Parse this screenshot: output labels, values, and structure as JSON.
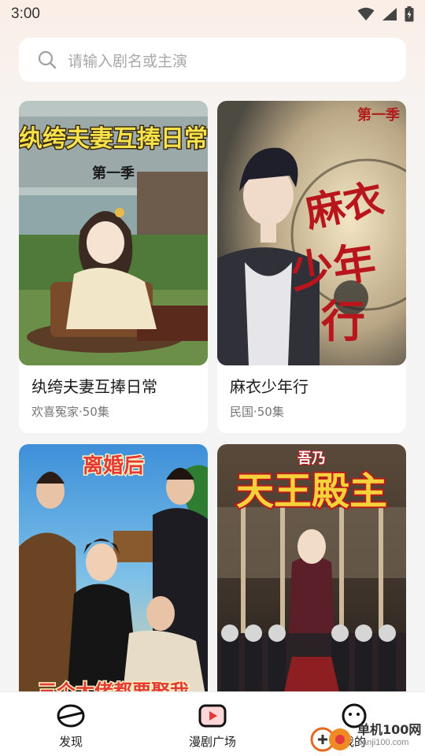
{
  "status_bar": {
    "time": "3:00"
  },
  "search": {
    "placeholder": "请输入剧名或主演"
  },
  "cards": [
    {
      "title": "纨绔夫妻互捧日常",
      "meta": "欢喜冤家·50集",
      "cover_title": "纨绔夫妻互捧日常",
      "cover_season": "第一季"
    },
    {
      "title": "麻衣少年行",
      "meta": "民国·50集",
      "cover_title": "麻衣少年行",
      "cover_season": "第一季"
    },
    {
      "title": "",
      "meta": "",
      "cover_title": "离婚后",
      "cover_subtitle": "三个大佬都要娶我"
    },
    {
      "title": "",
      "meta": "",
      "cover_title": "吾乃天王殿主",
      "cover_top": "吾乃",
      "cover_main": "天王殿主"
    }
  ],
  "tab_bar": {
    "items": [
      {
        "label": "发现",
        "icon": "discover-icon"
      },
      {
        "label": "漫剧广场",
        "icon": "play-square-icon"
      },
      {
        "label": "我的",
        "icon": "profile-face-icon"
      }
    ]
  },
  "watermark": {
    "main": "单机100网",
    "sub": "danji100.com"
  },
  "colors": {
    "background": "#f4f4f4",
    "card": "#ffffff",
    "placeholder": "#a8a8a8",
    "meta": "#777777",
    "accent_red": "#e4393c"
  }
}
